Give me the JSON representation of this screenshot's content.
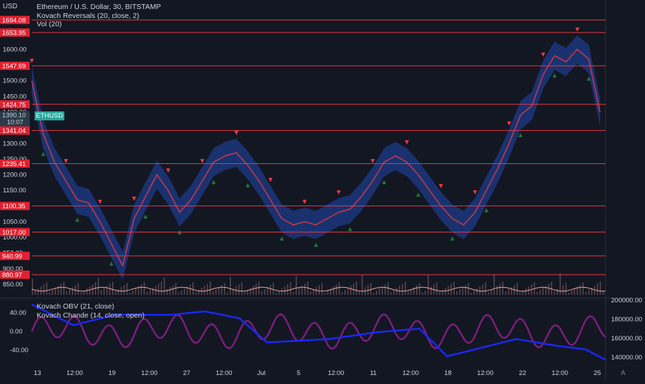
{
  "header": {
    "currency": "USD",
    "title": "Ethereum / U.S. Dollar, 30, BITSTAMP",
    "indicator1": "Kovach Reversals (20, close, 2)",
    "indicator2": "Vol (20)"
  },
  "lower_pane": {
    "indicator1": "Kovach OBV (21, close)",
    "indicator2": "Kovach Chande (14, close, open)"
  },
  "symbol_tag": "ETHUSD",
  "autoscale_label": "A",
  "colors": {
    "background": "#131722",
    "level_line": "#f23645",
    "price_line": "#f2364580",
    "band": "#2962ff",
    "up_marker": "#1b7a2e",
    "down_marker": "#f23645",
    "obv": "#1a28ff",
    "chande": "#7b1f7e",
    "volume": "#f2a79f"
  },
  "chart_data": [
    {
      "type": "line",
      "pane": "price",
      "y_ticks": [
        "1600.00",
        "1550.00",
        "1500.00",
        "1450.00",
        "1400.00",
        "1350.00",
        "1300.00",
        "1250.00",
        "1200.00",
        "1150.00",
        "1100.00",
        "1050.00",
        "1000.00",
        "950.00",
        "900.00",
        "850.00"
      ],
      "ylim": [
        850,
        1700
      ],
      "x_ticks": [
        "13",
        "12:00",
        "19",
        "12:00",
        "27",
        "12:00",
        "Jul",
        "5",
        "12:00",
        "11",
        "12:00",
        "18",
        "12:00",
        "22",
        "12:00",
        "25"
      ],
      "current_price": {
        "label": "1390.10",
        "countdown": "10:07",
        "value": 1390.1
      },
      "level_lines": [
        {
          "label": "1694.08",
          "value": 1694.08
        },
        {
          "label": "1653.95",
          "value": 1653.95
        },
        {
          "label": "1547.69",
          "value": 1547.69
        },
        {
          "label": "1424.75",
          "value": 1424.75
        },
        {
          "label": "1341.04",
          "value": 1341.04
        },
        {
          "label": "1235.41",
          "value": 1235.41
        },
        {
          "label": "1100.35",
          "value": 1100.35
        },
        {
          "label": "1017.00",
          "value": 1017.0
        },
        {
          "label": "940.99",
          "value": 940.99
        },
        {
          "label": "880.97",
          "value": 880.97
        }
      ],
      "series": [
        {
          "x": [
            0,
            2,
            4,
            6,
            8,
            10,
            12,
            14,
            16,
            18,
            20,
            22,
            24,
            26,
            28,
            30,
            32,
            34,
            36,
            38,
            40,
            42,
            44,
            46,
            48,
            50,
            52,
            54,
            56,
            58,
            60,
            62,
            64,
            66,
            68,
            70,
            72,
            74,
            76,
            78,
            80,
            82,
            84,
            86,
            88,
            90,
            92,
            94,
            96,
            98,
            100
          ],
          "values": [
            1500,
            1330,
            1240,
            1180,
            1120,
            1110,
            1050,
            980,
            910,
            1060,
            1130,
            1200,
            1150,
            1080,
            1120,
            1180,
            1240,
            1260,
            1270,
            1230,
            1180,
            1120,
            1060,
            1040,
            1050,
            1040,
            1060,
            1080,
            1090,
            1130,
            1180,
            1240,
            1260,
            1240,
            1200,
            1150,
            1100,
            1060,
            1040,
            1080,
            1150,
            1220,
            1300,
            1390,
            1420,
            1520,
            1580,
            1560,
            1600,
            1570,
            1400
          ]
        }
      ]
    },
    {
      "type": "line",
      "pane": "oscillator",
      "y_ticks_left": [
        "40.00",
        "0.00",
        "-40.00"
      ],
      "y_ticks_right": [
        "200000.00",
        "180000.00",
        "160000.00",
        "140000.00"
      ],
      "series": [
        {
          "name": "Kovach OBV (21, close)"
        },
        {
          "name": "Kovach Chande (14, close, open)"
        }
      ]
    }
  ]
}
